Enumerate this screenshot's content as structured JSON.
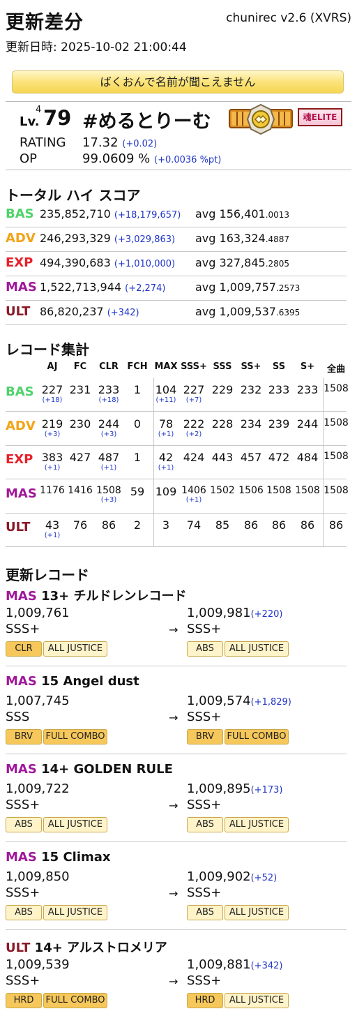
{
  "header": {
    "title": "更新差分",
    "version": "chunirec v2.6 (XVRS)",
    "updated": "更新日時: 2025-10-02 21:00:44"
  },
  "banner": "ばくおんで名前が聞こえません",
  "player": {
    "lv_label": "Lv.",
    "lv_sup": "4",
    "lv_num": "79",
    "name": "#めるとりーむ",
    "soul_label": "魂ELITE",
    "rating_label": "RATING",
    "rating_value": "17.32",
    "rating_diff": "(+0.02)",
    "op_label": "OP",
    "op_value": "99.0609 %",
    "op_diff": "(+0.0036 %pt)"
  },
  "colors": {
    "BAS": "#4fd36a",
    "ADV": "#f2a418",
    "EXP": "#e8202a",
    "MAS": "#a0189a",
    "ULT": "#8a1a28",
    "diff_blue": "#1f35c8"
  },
  "total_score": {
    "title": "トータル ハイ スコア",
    "rows": [
      {
        "diff": "BAS",
        "total": "235,852,710",
        "delta": "(+18,179,657)",
        "avg": "avg 156,401",
        "avg_dec": ".0013"
      },
      {
        "diff": "ADV",
        "total": "246,293,329",
        "delta": "(+3,029,863)",
        "avg": "avg 163,324",
        "avg_dec": ".4887"
      },
      {
        "diff": "EXP",
        "total": "494,390,683",
        "delta": "(+1,010,000)",
        "avg": "avg 327,845",
        "avg_dec": ".2805"
      },
      {
        "diff": "MAS",
        "total": "1,522,713,944",
        "delta": "(+2,274)",
        "avg": "avg 1,009,757",
        "avg_dec": ".2573"
      },
      {
        "diff": "ULT",
        "total": "86,820,237",
        "delta": "(+342)",
        "avg": "avg 1,009,537",
        "avg_dec": ".6395"
      }
    ]
  },
  "records": {
    "title": "レコード集計",
    "headers": [
      "AJ",
      "FC",
      "CLR",
      "FCH",
      "MAX",
      "SSS+",
      "SSS",
      "SS+",
      "SS",
      "S+",
      "全曲"
    ],
    "rows": [
      {
        "diff": "BAS",
        "cells": [
          [
            "227",
            "(+18)"
          ],
          [
            "231",
            ""
          ],
          [
            "233",
            "(+18)"
          ],
          [
            "1",
            ""
          ],
          [
            "104",
            "(+11)"
          ],
          [
            "227",
            "(+7)"
          ],
          [
            "229",
            ""
          ],
          [
            "232",
            ""
          ],
          [
            "233",
            ""
          ],
          [
            "233",
            ""
          ],
          [
            "1508",
            ""
          ]
        ]
      },
      {
        "diff": "ADV",
        "cells": [
          [
            "219",
            "(+3)"
          ],
          [
            "230",
            ""
          ],
          [
            "244",
            "(+3)"
          ],
          [
            "0",
            ""
          ],
          [
            "78",
            "(+1)"
          ],
          [
            "222",
            "(+2)"
          ],
          [
            "228",
            ""
          ],
          [
            "234",
            ""
          ],
          [
            "239",
            ""
          ],
          [
            "244",
            ""
          ],
          [
            "1508",
            ""
          ]
        ]
      },
      {
        "diff": "EXP",
        "cells": [
          [
            "383",
            "(+1)"
          ],
          [
            "427",
            ""
          ],
          [
            "487",
            "(+1)"
          ],
          [
            "1",
            ""
          ],
          [
            "42",
            "(+1)"
          ],
          [
            "424",
            ""
          ],
          [
            "443",
            ""
          ],
          [
            "457",
            ""
          ],
          [
            "472",
            ""
          ],
          [
            "484",
            ""
          ],
          [
            "1508",
            ""
          ]
        ]
      },
      {
        "diff": "MAS",
        "cells": [
          [
            "1176",
            ""
          ],
          [
            "1416",
            ""
          ],
          [
            "1508",
            "(+3)"
          ],
          [
            "59",
            ""
          ],
          [
            "109",
            ""
          ],
          [
            "1406",
            "(+1)"
          ],
          [
            "1502",
            ""
          ],
          [
            "1506",
            ""
          ],
          [
            "1508",
            ""
          ],
          [
            "1508",
            ""
          ],
          [
            "1508",
            ""
          ]
        ]
      },
      {
        "diff": "ULT",
        "cells": [
          [
            "43",
            "(+1)"
          ],
          [
            "76",
            ""
          ],
          [
            "86",
            ""
          ],
          [
            "2",
            ""
          ],
          [
            "3",
            ""
          ],
          [
            "74",
            ""
          ],
          [
            "85",
            ""
          ],
          [
            "86",
            ""
          ],
          [
            "86",
            ""
          ],
          [
            "86",
            ""
          ],
          [
            "86",
            ""
          ]
        ]
      }
    ]
  },
  "updates": {
    "title": "更新レコード",
    "arrow": "→",
    "items": [
      {
        "diff": "MAS",
        "level": "13+",
        "song": "チルドレンレコード",
        "old_score": "1,009,761",
        "old_rank": "SSS+",
        "old_badges": [
          "CLR",
          "ALL JUSTICE"
        ],
        "new_score": "1,009,981",
        "new_delta": "(+220)",
        "new_rank": "SSS+",
        "new_badges": [
          "ABS",
          "ALL JUSTICE"
        ]
      },
      {
        "diff": "MAS",
        "level": "15",
        "song": "Angel dust",
        "old_score": "1,007,745",
        "old_rank": "SSS",
        "old_badges": [
          "BRV",
          "FULL COMBO"
        ],
        "new_score": "1,009,574",
        "new_delta": "(+1,829)",
        "new_rank": "SSS+",
        "new_badges": [
          "BRV",
          "FULL COMBO"
        ]
      },
      {
        "diff": "MAS",
        "level": "14+",
        "song": "GOLDEN RULE",
        "old_score": "1,009,722",
        "old_rank": "SSS+",
        "old_badges": [
          "ABS",
          "ALL JUSTICE"
        ],
        "new_score": "1,009,895",
        "new_delta": "(+173)",
        "new_rank": "SSS+",
        "new_badges": [
          "ABS",
          "ALL JUSTICE"
        ]
      },
      {
        "diff": "MAS",
        "level": "15",
        "song": "Climax",
        "old_score": "1,009,850",
        "old_rank": "SSS+",
        "old_badges": [
          "ABS",
          "ALL JUSTICE"
        ],
        "new_score": "1,009,902",
        "new_delta": "(+52)",
        "new_rank": "SSS+",
        "new_badges": [
          "ABS",
          "ALL JUSTICE"
        ]
      },
      {
        "diff": "ULT",
        "level": "14+",
        "song": "アルストロメリア",
        "old_score": "1,009,539",
        "old_rank": "SSS+",
        "old_badges": [
          "HRD",
          "FULL COMBO"
        ],
        "new_score": "1,009,881",
        "new_delta": "(+342)",
        "new_rank": "SSS+",
        "new_badges": [
          "HRD",
          "ALL JUSTICE"
        ]
      }
    ]
  }
}
